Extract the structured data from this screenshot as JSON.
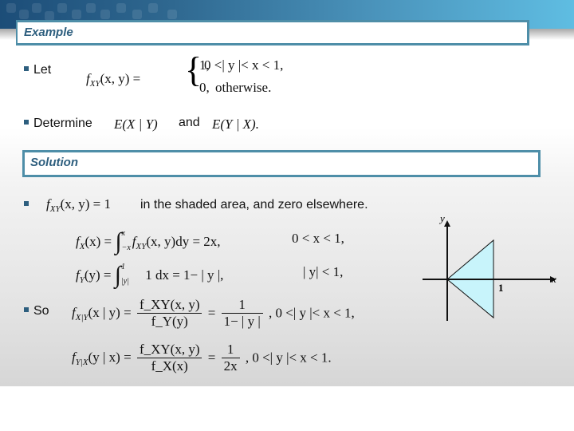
{
  "header": {
    "title": "Example"
  },
  "problem": {
    "bullet1_label": "Let",
    "pdf_lhs": "f",
    "pdf_lhs_sub": "XY",
    "pdf_lhs_args": "(x, y) =",
    "case1_value": "1,",
    "case1_condition": "0 <| y |< x < 1,",
    "case2_value": "0,",
    "case2_condition": "otherwise.",
    "bullet2_label": "Determine",
    "expr1": "E(X | Y)",
    "conjunction": "and",
    "expr2": "E(Y | X)."
  },
  "solution": {
    "title": "Solution",
    "line1_math": "f",
    "line1_sub": "XY",
    "line1_args": "(x, y) = 1",
    "line1_text": "in the shaded area, and zero elsewhere.",
    "fx_lhs": "f",
    "fx_sub": "X",
    "fx_args": "(x) =",
    "fx_upper": "x",
    "fx_lower": "−x",
    "fx_integrand": "f",
    "fx_integrand_sub": "XY",
    "fx_integrand_args": "(x, y)dy = 2x,",
    "fx_condition": "0 < x < 1,",
    "fy_lhs": "f",
    "fy_sub": "Y",
    "fy_args": "(y) =",
    "fy_upper": "1",
    "fy_lower": "|y|",
    "fy_integrand": "1  dx = 1− | y |,",
    "fy_condition": "| y| < 1,",
    "bullet_so": "So",
    "cond1_lhs": "f",
    "cond1_sub": "X|Y",
    "cond1_args": "(x | y) =",
    "cond1_num": "f_XY(x, y)",
    "cond1_den": "f_Y(y)",
    "cond1_eq": "=",
    "cond1_num2": "1",
    "cond1_den2": "1− | y |",
    "cond1_condition": ",     0 <| y |< x < 1,",
    "cond2_lhs": "f",
    "cond2_sub": "Y|X",
    "cond2_args": "(y | x) =",
    "cond2_num": "f_XY(x, y)",
    "cond2_den": "f_X(x)",
    "cond2_eq": "=",
    "cond2_num2": "1",
    "cond2_den2": "2x",
    "cond2_condition": ",     0 <| y |< x < 1."
  },
  "figure": {
    "x_label": "x",
    "y_label": "y",
    "tick_label": "1",
    "shade_color": "#c8f4fb"
  }
}
